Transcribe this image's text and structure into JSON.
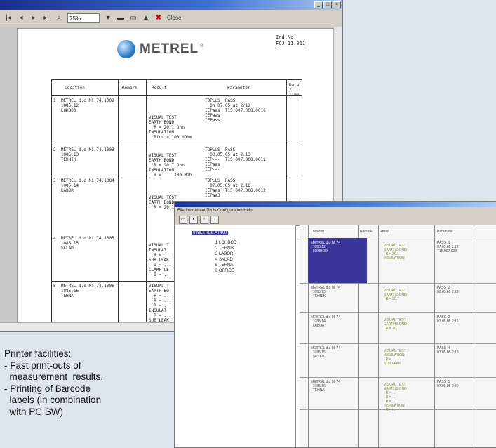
{
  "print_window": {
    "zoom": "75%",
    "close_label": "Close",
    "logo_text": "METREL",
    "header_right": [
      "Ind.No.",
      "FCJ 11.011"
    ],
    "table_header": [
      "Location",
      "Remark",
      "Result",
      "Parameter",
      "Date / Time"
    ],
    "rows": [
      {
        "loc": "1  METREL d.d Mi 74.1002\n   1085.12\n   LOHBOD",
        "res": "VISUAL TEST\nEARTH BOND\n  R = 20.1 Ohm\nINSULATION\n  Rins > 100 MOhm",
        "par": "TOPLUS  PASS\n  Dn 07.05 at 2/12\nIEPaas  T15.007.008.0010\nIEPaas\nIEPass"
      },
      {
        "loc": "2  METREL d.d Mi 74.1003\n   1085.13\n   TEHNIK",
        "res": "VISUAL TEST\nEARTH BOND\n  R = 20.7 Ohm\nINSULATION\n  R = ... 100 MOh",
        "par": "TOPLUS  PASS\n  00.05.05 at 2.13\nIEP---  T15.007.008.0011\nIEPaas\nIEP---"
      },
      {
        "loc": "3  METREL d.d Mi 74.1004\n   1085.14\n   LABOR",
        "res": "VISUAL TEST\nEARTH BOND\n  R = 20.1 Ohm",
        "par": "TOPLUS  PASS\n  07.05.05 at 2.16\nIEPaas  T15.007.008.0012\nIEPaa3"
      },
      {
        "loc": "4  METREL d.d Mi 74.1005\n   1085.15\n   SKLAD",
        "res": "VISUAL T\nINSULAT\n  R = ...\nSUB LEAK\n  I = ...\nCLAMP LE\n  I = ...",
        "par": ""
      },
      {
        "loc": "5  METREL d.d Mi 74.1006\n   1085.16\n   TEHNA",
        "res": "VISUAL T\nEARTH BO\n  R = ...\n  R = ...\n  R = ...\nINSULAT\n  R = ...\nSUB LEAK\n  I = ...",
        "par": ""
      }
    ]
  },
  "explorer_window": {
    "menu": "File  Instrument  Tools  Configuration  Help",
    "tree_root": "0 METREL.AT400",
    "tree_items": [
      "1 LOHBOD",
      "2 TEHNIK",
      "3 LABOR",
      "4 SKLAD",
      "5 TEHNA",
      "6 OFFICE"
    ],
    "col_headers": [
      "Location",
      "Remark",
      "Result",
      "Parameter"
    ]
  },
  "caption": {
    "title": "Printer facilities:",
    "items": [
      "- Fast print-outs of",
      "  measurement  results.",
      "- Printing of Barcode",
      "  labels (in combination",
      "  with PC SW)"
    ]
  }
}
